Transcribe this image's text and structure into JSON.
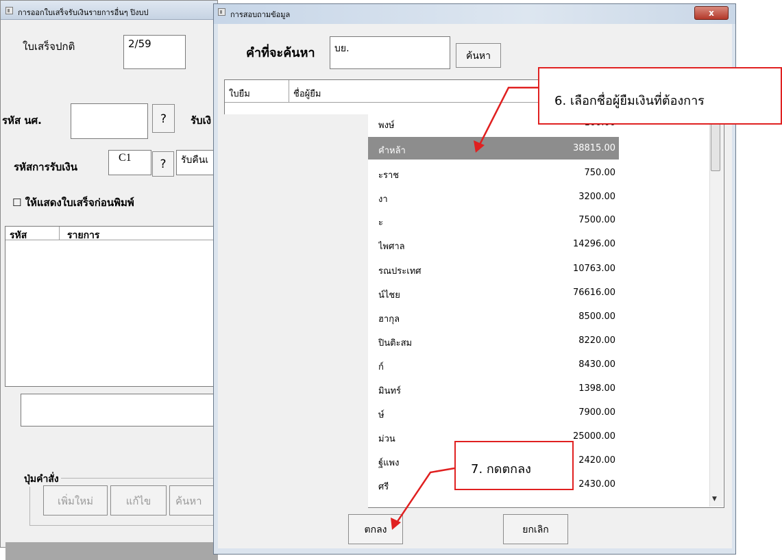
{
  "main_window": {
    "title": "การออกใบเสร็จรับเงินรายการอื่นๆ ปิงบป",
    "receipt_label": "ใบเสร็จปกติ",
    "receipt_value": "2/59",
    "student_code_label": "รหัส นศ.",
    "student_code_value": "",
    "lookup_q": "?",
    "receive_label": "รับเงิ",
    "payment_code_label": "รหัสการรับเงิน",
    "payment_code_value": "C1",
    "payment_name_value": "รับคืนเ",
    "show_receipt_checkbox": "☐ ให้แสดงใบเสร็จก่อนพิมพ์",
    "col_code": "รหัส",
    "col_item": "รายการ",
    "command_group_label": "ปุ่มคำสั่ง",
    "btn_new": "เพิ่มใหม่",
    "btn_edit": "แก้ไข",
    "btn_search": "ค้นหา"
  },
  "dialog": {
    "title": "การสอบถามข้อมูล",
    "close": "x",
    "search_label": "คำที่จะค้นหา",
    "search_value": "บย.",
    "search_button": "ค้นหา",
    "col_doc": "ใบยืม",
    "col_name": "ชื่อผู้ยืม",
    "rows": [
      {
        "name": "พงษ์",
        "amount": "100.00"
      },
      {
        "name": "คำหล้า",
        "amount": "38815.00"
      },
      {
        "name": "ะราช",
        "amount": "750.00"
      },
      {
        "name": "งา",
        "amount": "3200.00"
      },
      {
        "name": "ะ",
        "amount": "7500.00"
      },
      {
        "name": "ไพศาล",
        "amount": "14296.00"
      },
      {
        "name": "รณประเทศ",
        "amount": "10763.00"
      },
      {
        "name": "น์ไชย",
        "amount": "76616.00"
      },
      {
        "name": "ฮากุล",
        "amount": "8500.00"
      },
      {
        "name": "ปินติะสม",
        "amount": "8220.00"
      },
      {
        "name": "ก์",
        "amount": "8430.00"
      },
      {
        "name": "มินทร์",
        "amount": "1398.00"
      },
      {
        "name": "ษ์",
        "amount": "7900.00"
      },
      {
        "name": "ม่วน",
        "amount": "25000.00"
      },
      {
        "name": "ฐ์แพง",
        "amount": "2420.00"
      },
      {
        "name": "ศรี",
        "amount": "2430.00"
      }
    ],
    "ok_button": "ตกลง",
    "cancel_button": "ยกเลิก"
  },
  "callouts": {
    "step6": "6. เลือกชื่อผู้ยืมเงินที่ต้องการ",
    "step7": "7. กดตกลง"
  },
  "colors": {
    "highlight": "#e02020",
    "selected_row": "#8d8d8d"
  }
}
